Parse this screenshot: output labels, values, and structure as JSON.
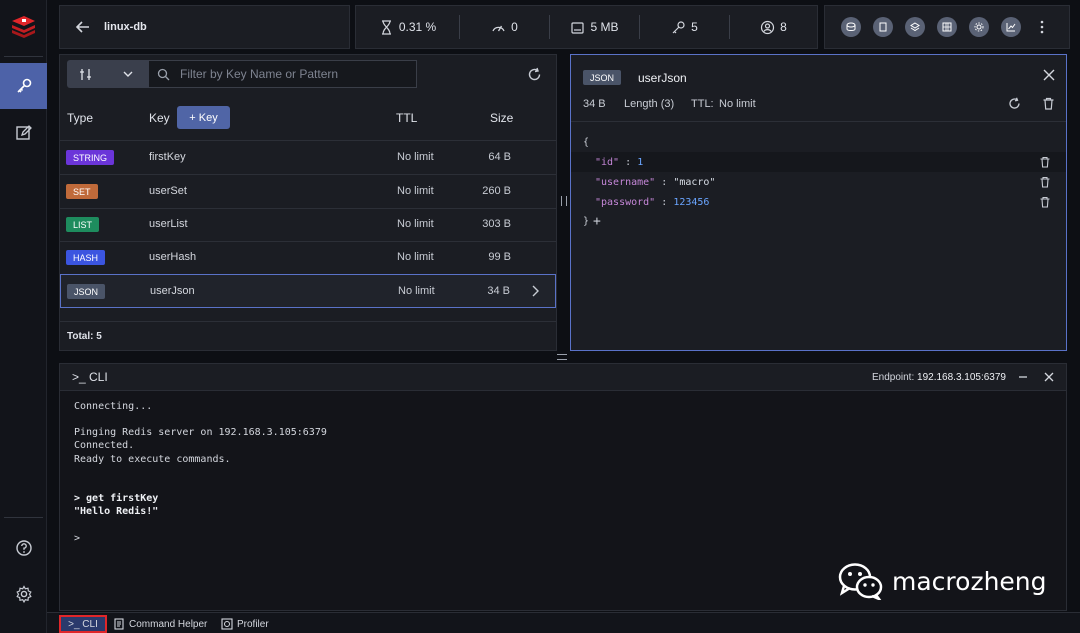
{
  "sidebar": {
    "items": [
      {
        "name": "browser",
        "icon": "key-icon",
        "active": true
      },
      {
        "name": "workbench",
        "icon": "edit-icon",
        "active": false
      }
    ],
    "bottom": [
      {
        "name": "help",
        "icon": "help-icon"
      },
      {
        "name": "settings",
        "icon": "gear-icon"
      }
    ]
  },
  "header": {
    "db_name": "linux-db",
    "stats": {
      "cpu": "0.31 %",
      "ops": "0",
      "memory": "5 MB",
      "keys": "5",
      "clients": "8"
    }
  },
  "keys_panel": {
    "filter_placeholder": "Filter by Key Name or Pattern",
    "columns": {
      "type": "Type",
      "key": "Key",
      "ttl": "TTL",
      "size": "Size"
    },
    "add_key_label": "+ Key",
    "rows": [
      {
        "type": "STRING",
        "color": "#6b35d9",
        "key": "firstKey",
        "ttl": "No limit",
        "size": "64 B"
      },
      {
        "type": "SET",
        "color": "#c06a3a",
        "key": "userSet",
        "ttl": "No limit",
        "size": "260 B"
      },
      {
        "type": "LIST",
        "color": "#1e8c5e",
        "key": "userList",
        "ttl": "No limit",
        "size": "303 B"
      },
      {
        "type": "HASH",
        "color": "#3b55e0",
        "key": "userHash",
        "ttl": "No limit",
        "size": "99 B"
      },
      {
        "type": "JSON",
        "color": "#4a5468",
        "key": "userJson",
        "ttl": "No limit",
        "size": "34 B"
      }
    ],
    "total": "Total: 5"
  },
  "detail": {
    "type": "JSON",
    "key": "userJson",
    "size": "34 B",
    "length": "Length (3)",
    "ttl_label": "TTL:",
    "ttl_value": "No limit",
    "json": {
      "open": "{",
      "close": "}",
      "add": "+",
      "entries": [
        {
          "key": "\"id\"",
          "sep": ":",
          "value": "1",
          "kind": "num"
        },
        {
          "key": "\"username\"",
          "sep": ":",
          "value": "\"macro\"",
          "kind": "str"
        },
        {
          "key": "\"password\"",
          "sep": ":",
          "value": "123456",
          "kind": "num"
        }
      ]
    }
  },
  "cli": {
    "title": ">_ CLI",
    "endpoint_label": "Endpoint:",
    "endpoint": "192.168.3.105:6379",
    "lines": [
      {
        "text": "Connecting...",
        "bold": false
      },
      {
        "text": "Pinging Redis server on 192.168.3.105:6379",
        "bold": false
      },
      {
        "text": "Connected.",
        "bold": false
      },
      {
        "text": "Ready to execute commands.",
        "bold": false
      },
      {
        "text": "> get firstKey",
        "bold": true
      },
      {
        "text": "\"Hello Redis!\"",
        "bold": true
      },
      {
        "text": ">",
        "bold": false
      }
    ]
  },
  "bottom_tabs": {
    "cli": ">_ CLI",
    "command_helper": "Command Helper",
    "profiler": "Profiler"
  },
  "watermark": "macrozheng"
}
